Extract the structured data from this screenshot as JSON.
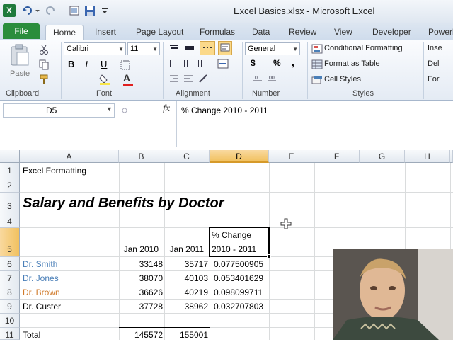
{
  "window": {
    "title": "Excel Basics.xlsx - Microsoft Excel"
  },
  "tabs": [
    "File",
    "Home",
    "Insert",
    "Page Layout",
    "Formulas",
    "Data",
    "Review",
    "View",
    "Developer",
    "Powerl"
  ],
  "ribbon": {
    "clipboard": {
      "paste_label": "Paste",
      "group_label": "Clipboard"
    },
    "font": {
      "name": "Calibri",
      "size": "11",
      "group_label": "Font",
      "bold": "B",
      "italic": "I",
      "underline": "U",
      "font_color_glyph": "A"
    },
    "alignment": {
      "group_label": "Alignment"
    },
    "number": {
      "format": "General",
      "currency": "$",
      "percent": "%",
      "comma": ",",
      "group_label": "Number"
    },
    "styles": {
      "conditional": "Conditional Formatting",
      "table": "Format as Table",
      "cell_styles": "Cell Styles",
      "group_label": "Styles"
    },
    "cells": {
      "insert": "Inse",
      "delete": "Del",
      "format": "For"
    }
  },
  "formula_bar": {
    "name_box": "D5",
    "fx": "fx",
    "content": "% Change 2010 - 2011"
  },
  "columns": [
    "A",
    "B",
    "C",
    "D",
    "E",
    "F",
    "G",
    "H"
  ],
  "rows": [
    "1",
    "2",
    "3",
    "4",
    "5",
    "6",
    "7",
    "8",
    "9",
    "10",
    "11"
  ],
  "cells": {
    "a1": "Excel Formatting",
    "a3": "Salary and Benefits by Doctor",
    "b5": "Jan 2010",
    "c5": "Jan 2011",
    "d5_line1": "% Change",
    "d5_line2": "2010 - 2011",
    "data": [
      {
        "name": "Dr. Smith",
        "b": "33148",
        "c": "35717",
        "d": "0.077500905"
      },
      {
        "name": "Dr. Jones",
        "b": "38070",
        "c": "40103",
        "d": "0.053401629"
      },
      {
        "name": "Dr. Brown",
        "b": "36626",
        "c": "40219",
        "d": "0.098099711"
      },
      {
        "name": "Dr. Custer",
        "b": "37728",
        "c": "38962",
        "d": "0.032707803"
      }
    ],
    "a11": "Total",
    "b11": "145572",
    "c11": "155001"
  },
  "colors": {
    "file_tab": "#2a8d3c",
    "selection": "#f1c15f",
    "smith_jones": "#4a7fb8",
    "brown": "#d07a2a"
  }
}
